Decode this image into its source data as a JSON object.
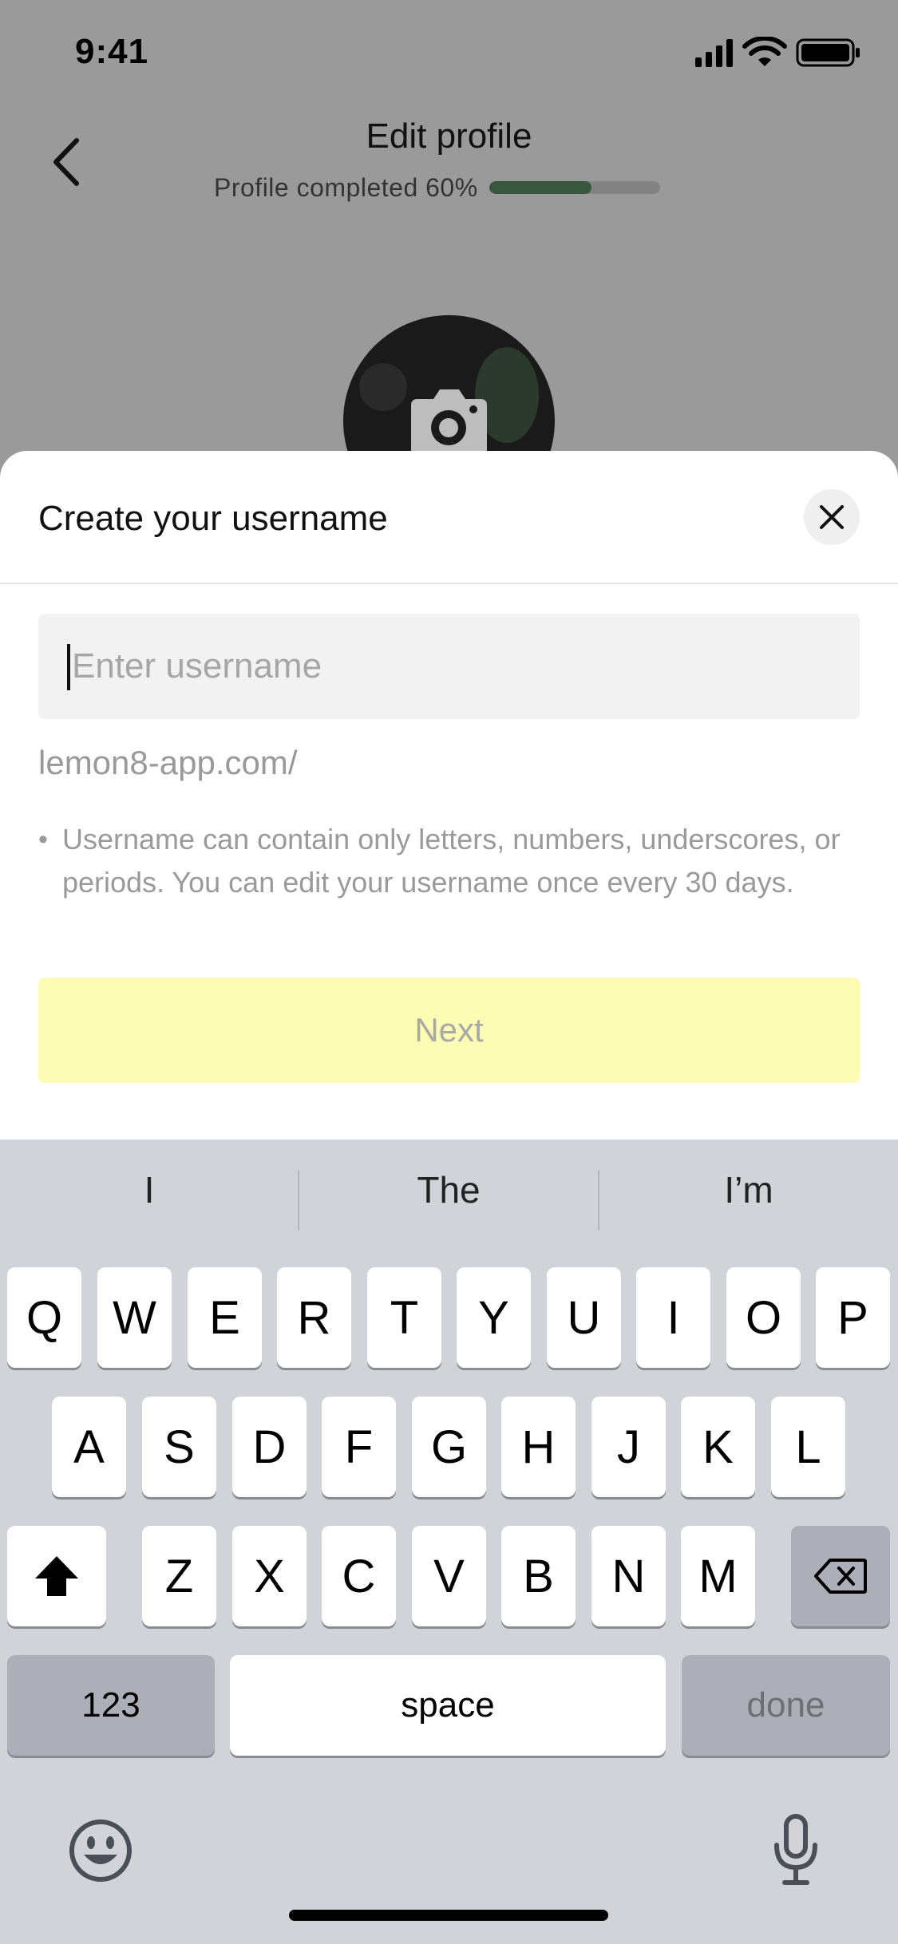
{
  "status_bar": {
    "time": "9:41"
  },
  "header": {
    "title": "Edit profile",
    "progress_label": "Profile completed 60%",
    "progress_fraction": 0.6
  },
  "sheet": {
    "title": "Create your username",
    "input_placeholder": "Enter username",
    "input_value": "",
    "url_prefix": "lemon8-app.com/",
    "hint_bullet": "•",
    "hint": "Username can contain only letters, numbers, underscores, or periods. You can edit your username once every 30 days.",
    "next_label": "Next"
  },
  "keyboard": {
    "suggestions": [
      "I",
      "The",
      "I’m"
    ],
    "row1": [
      "Q",
      "W",
      "E",
      "R",
      "T",
      "Y",
      "U",
      "I",
      "O",
      "P"
    ],
    "row2": [
      "A",
      "S",
      "D",
      "F",
      "G",
      "H",
      "J",
      "K",
      "L"
    ],
    "row3": [
      "Z",
      "X",
      "C",
      "V",
      "B",
      "N",
      "M"
    ],
    "numbers_label": "123",
    "space_label": "space",
    "done_label": "done"
  },
  "colors": {
    "accent_progress": "#39573f",
    "next_button_bg": "#fdfcb4",
    "keyboard_bg": "#d1d3d9"
  },
  "icons": [
    "back-chevron-icon",
    "camera-icon",
    "close-icon",
    "shift-icon",
    "backspace-icon",
    "emoji-icon",
    "microphone-icon",
    "signal-icon",
    "wifi-icon",
    "battery-icon"
  ]
}
